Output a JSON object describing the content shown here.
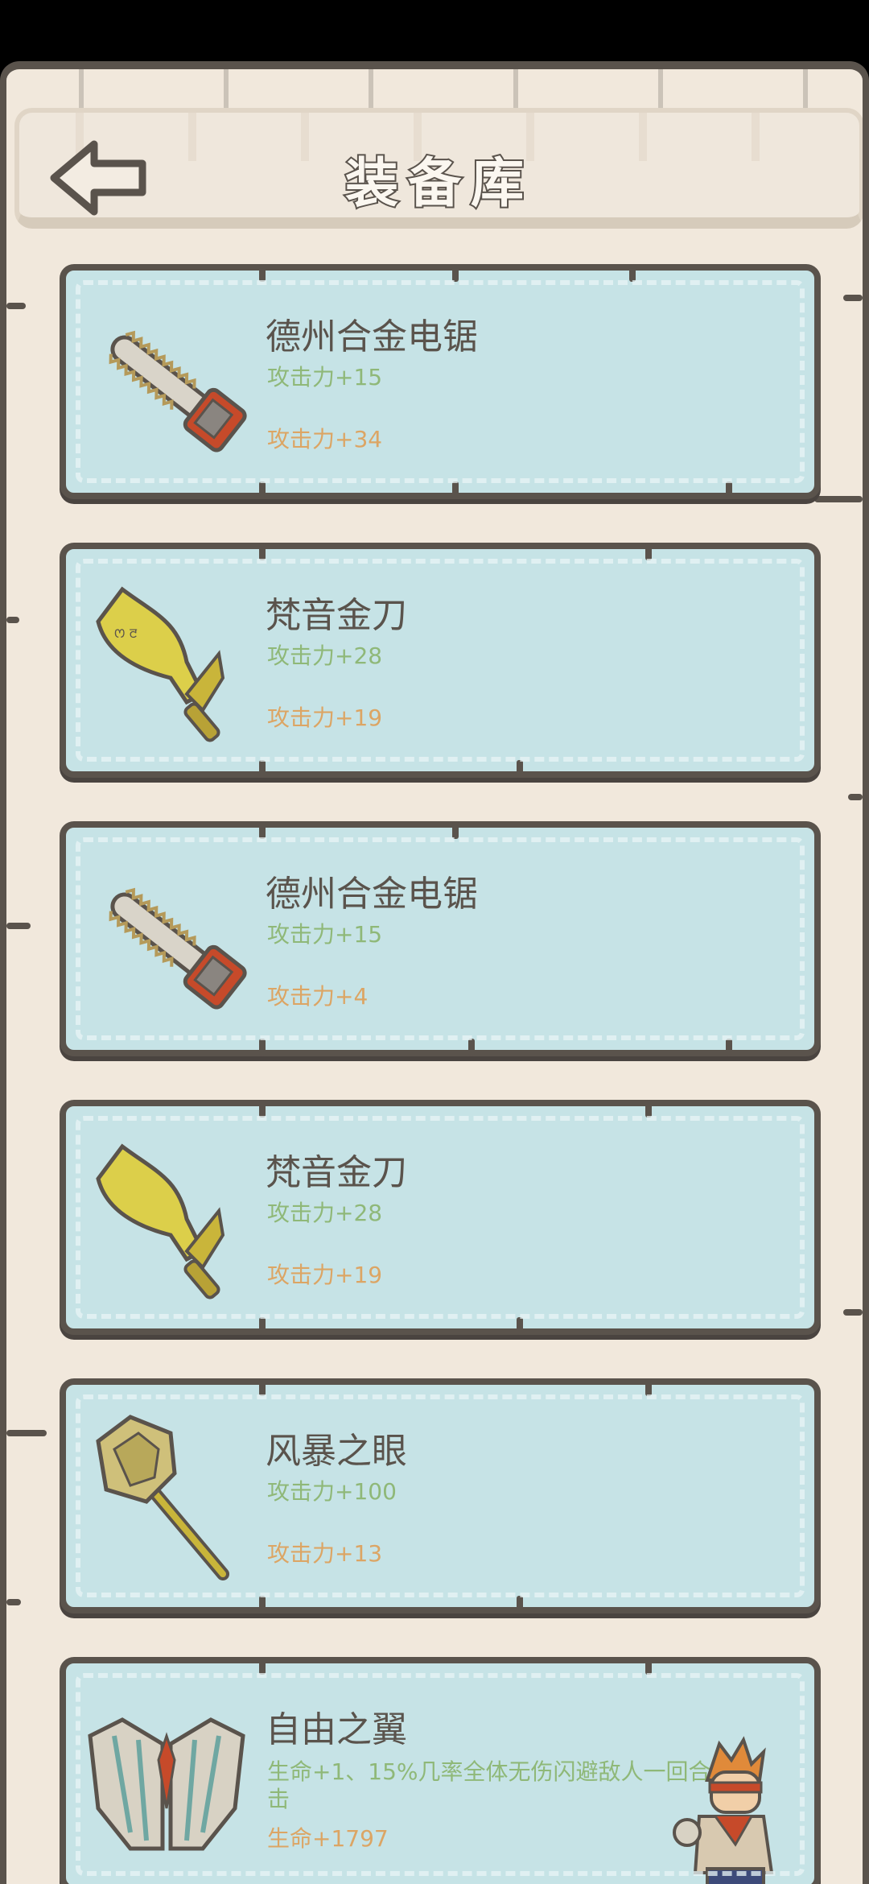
{
  "header": {
    "title": "装备库"
  },
  "equipment": [
    {
      "name": "德州合金电锯",
      "stat1": "攻击力+15",
      "stat2": "攻击力+34",
      "icon": "chainsaw-icon"
    },
    {
      "name": "梵音金刀",
      "stat1": "攻击力+28",
      "stat2": "攻击力+19",
      "icon": "golden-blade-icon"
    },
    {
      "name": "德州合金电锯",
      "stat1": "攻击力+15",
      "stat2": "攻击力+4",
      "icon": "chainsaw-icon"
    },
    {
      "name": "梵音金刀",
      "stat1": "攻击力+28",
      "stat2": "攻击力+19",
      "icon": "golden-blade-icon"
    },
    {
      "name": "风暴之眼",
      "stat1": "攻击力+100",
      "stat2": "攻击力+13",
      "icon": "mace-icon"
    },
    {
      "name": "自由之翼",
      "stat1": "生命+1、15%几率全体无伤闪避敌人一回合击",
      "stat2": "生命+1797",
      "icon": "wings-icon"
    }
  ],
  "colors": {
    "card": "#c6e3e6",
    "outline": "#5a534c",
    "stat_green": "#8fb878",
    "stat_orange": "#dca564"
  }
}
